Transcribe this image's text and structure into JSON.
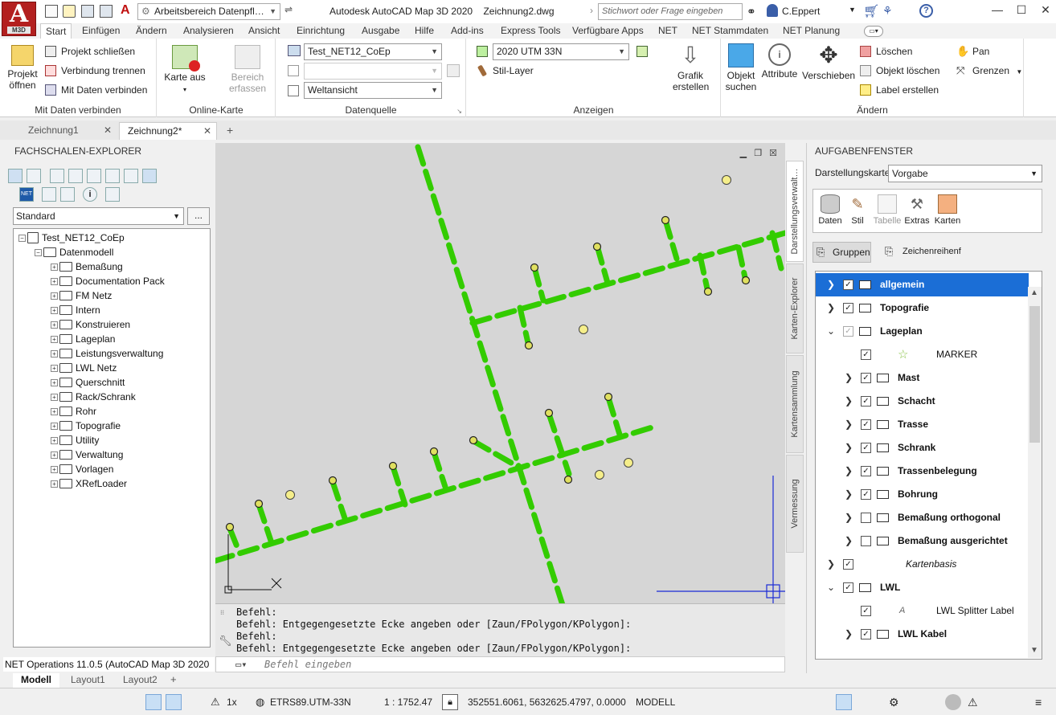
{
  "title_bar": {
    "app_logo": {
      "letter": "A",
      "sub": "M3D"
    },
    "workspace": "Arbeitsbereich Datenpfl…",
    "app_title": "Autodesk AutoCAD Map 3D 2020    Zeichnung2.dwg",
    "search_placeholder": "Stichwort oder Frage eingeben",
    "user": "C.Eppert"
  },
  "ribbon_tabs": [
    "Start",
    "Einfügen",
    "Ändern",
    "Analysieren",
    "Ansicht",
    "Einrichtung",
    "Ausgabe",
    "Hilfe",
    "Add-ins",
    "Express Tools",
    "Verfügbare Apps",
    "NET",
    "NET Stammdaten",
    "NET Planung"
  ],
  "ribbon": {
    "connect": {
      "title": "Mit Daten verbinden",
      "open_project": "Projekt öffnen",
      "close_project": "Projekt schließen",
      "disconnect": "Verbindung trennen",
      "connect_data": "Mit Daten verbinden"
    },
    "online_map": {
      "title": "Online-Karte",
      "map_off": "Karte aus"
    },
    "area": {
      "label": "Bereich erfassen"
    },
    "datasource": {
      "title": "Datenquelle",
      "source_value": "Test_NET12_CoEp",
      "empty_value": "",
      "view_value": "Weltansicht"
    },
    "display": {
      "title": "Anzeigen",
      "crs_value": "2020 UTM 33N",
      "style_layer": "Stil-Layer",
      "create_graphic": "Grafik erstellen"
    },
    "edit": {
      "title": "Ändern",
      "find_object": "Objekt suchen",
      "attributes": "Attribute",
      "move": "Verschieben",
      "delete": "Löschen",
      "delete_object": "Objekt löschen",
      "create_label": "Label erstellen",
      "pan": "Pan",
      "bounds": "Grenzen"
    }
  },
  "doc_tabs": [
    {
      "label": "Zeichnung1",
      "active": false
    },
    {
      "label": "Zeichnung2*",
      "active": true
    }
  ],
  "explorer": {
    "title": "FACHSCHALEN-EXPLORER",
    "profile": "Standard",
    "ellipsis": "...",
    "root": "Test_NET12_CoEp",
    "model": "Datenmodell",
    "folders": [
      "Bemaßung",
      "Documentation Pack",
      "FM Netz",
      "Intern",
      "Konstruieren",
      "Lageplan",
      "Leistungsverwaltung",
      "LWL Netz",
      "Querschnitt",
      "Rack/Schrank",
      "Rohr",
      "Topografie",
      "Utility",
      "Verwaltung",
      "Vorlagen",
      "XRefLoader"
    ],
    "status": "NET Operations 11.0.5 (AutoCAD Map 3D 2020"
  },
  "command_line": {
    "lines": [
      "Befehl:",
      "Befehl: Entgegengesetzte Ecke angeben oder [Zaun/FPolygon/KPolygon]:",
      "Befehl:",
      "Befehl: Entgegengesetzte Ecke angeben oder [Zaun/FPolygon/KPolygon]:"
    ],
    "placeholder": "Befehl eingeben"
  },
  "task_pane": {
    "title": "AUFGABENFENSTER",
    "vertical_tabs": [
      "Darstellungsverwalt…",
      "Karten-Explorer",
      "Kartensammlung",
      "Vermessung"
    ],
    "map_label": "Darstellungskarte:",
    "map_value": "Vorgabe",
    "tools": [
      "Daten",
      "Stil",
      "Tabelle",
      "Extras",
      "Karten"
    ],
    "groups_btn": "Gruppen",
    "draw_order_btn": "Zeichenreihenf",
    "layers": [
      {
        "label": "allgemein",
        "level": 0,
        "expander": "›",
        "checked": true,
        "folder": true,
        "selected": true
      },
      {
        "label": "Topografie",
        "level": 0,
        "expander": "›",
        "checked": true,
        "folder": true
      },
      {
        "label": "Lageplan",
        "level": 0,
        "expander": "⌄",
        "checked": true,
        "gray": true,
        "folder": true
      },
      {
        "label": "MARKER",
        "level": 1,
        "expander": "",
        "checked": true,
        "folder": false,
        "star": true
      },
      {
        "label": "Mast",
        "level": 1,
        "expander": "›",
        "checked": true,
        "folder": true
      },
      {
        "label": "Schacht",
        "level": 1,
        "expander": "›",
        "checked": true,
        "folder": true
      },
      {
        "label": "Trasse",
        "level": 1,
        "expander": "›",
        "checked": true,
        "folder": true
      },
      {
        "label": "Schrank",
        "level": 1,
        "expander": "›",
        "checked": true,
        "folder": true
      },
      {
        "label": "Trassenbelegung",
        "level": 1,
        "expander": "›",
        "checked": true,
        "folder": true
      },
      {
        "label": "Bohrung",
        "level": 1,
        "expander": "›",
        "checked": true,
        "folder": true
      },
      {
        "label": "Bemaßung orthogonal",
        "level": 1,
        "expander": "›",
        "checked": false,
        "folder": true
      },
      {
        "label": "Bemaßung ausgerichtet",
        "level": 1,
        "expander": "›",
        "checked": false,
        "folder": true
      },
      {
        "label": "Kartenbasis",
        "level": 0,
        "expander": "›",
        "checked": true,
        "folder": false,
        "italic": true
      },
      {
        "label": "LWL",
        "level": 0,
        "expander": "⌄",
        "checked": true,
        "folder": true
      },
      {
        "label": "LWL Splitter Label",
        "level": 1,
        "expander": "",
        "checked": true,
        "folder": false,
        "text_icon": true
      },
      {
        "label": "LWL Kabel",
        "level": 1,
        "expander": "›",
        "checked": true,
        "folder": true
      }
    ]
  },
  "layout_tabs": [
    "Modell",
    "Layout1",
    "Layout2"
  ],
  "status_bar": {
    "scale_factor": "1x",
    "crs": "ETRS89.UTM-33N",
    "scale": "1 : 1752.47",
    "coords": "352551.6061, 5632625.4797, 0.0000",
    "mode": "MODELL"
  },
  "colors": {
    "accent": "#1b6ed6",
    "line_green": "#33cc00",
    "canvas_bg": "#d6d6d6",
    "point_yellow": "#f5ee8a"
  }
}
